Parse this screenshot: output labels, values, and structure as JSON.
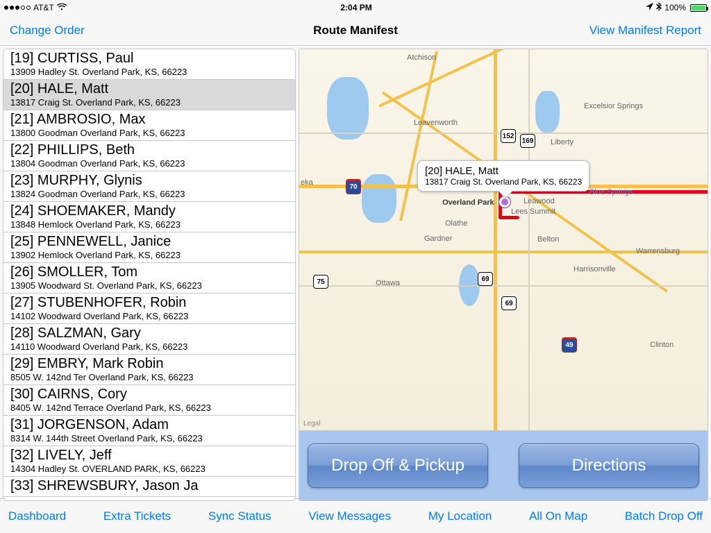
{
  "status": {
    "carrier": "AT&T",
    "time": "2:04 PM",
    "battery_text": "100%"
  },
  "nav": {
    "left": "Change Order",
    "title": "Route Manifest",
    "right": "View Manifest Report"
  },
  "selected_index": 1,
  "manifest": [
    {
      "stop": "[19]",
      "name": "CURTISS, Paul",
      "addr": "13909 Hadley St. Overland Park, KS, 66223"
    },
    {
      "stop": "[20]",
      "name": "HALE, Matt",
      "addr": "13817 Craig St. Overland Park, KS, 66223"
    },
    {
      "stop": "[21]",
      "name": "AMBROSIO, Max",
      "addr": "13800 Goodman Overland Park, KS, 66223"
    },
    {
      "stop": "[22]",
      "name": "PHILLIPS, Beth",
      "addr": "13804 Goodman Overland Park, KS, 66223"
    },
    {
      "stop": "[23]",
      "name": "MURPHY, Glynis",
      "addr": "13824 Goodman Overland Park, KS, 66223"
    },
    {
      "stop": "[24]",
      "name": "SHOEMAKER, Mandy",
      "addr": "13848 Hemlock Overland Park, KS, 66223"
    },
    {
      "stop": "[25]",
      "name": "PENNEWELL, Janice",
      "addr": "13902 Hemlock Overland Park, KS, 66223"
    },
    {
      "stop": "[26]",
      "name": "SMOLLER, Tom",
      "addr": "13905 Woodward St. Overland Park, KS, 66223"
    },
    {
      "stop": "[27]",
      "name": "STUBENHOFER, Robin",
      "addr": "14102 Woodward Overland Park, KS, 66223"
    },
    {
      "stop": "[28]",
      "name": "SALZMAN, Gary",
      "addr": "14110 Woodward Overland Park, KS, 66223"
    },
    {
      "stop": "[29]",
      "name": "EMBRY, Mark   Robin",
      "addr": "8505 W. 142nd Ter Overland Park, KS, 66223"
    },
    {
      "stop": "[30]",
      "name": "CAIRNS, Cory",
      "addr": "8405 W. 142nd Terrace Overland Park, KS, 66223"
    },
    {
      "stop": "[31]",
      "name": "JORGENSON, Adam",
      "addr": "8314 W. 144th Street Overland Park, KS, 66223"
    },
    {
      "stop": "[32]",
      "name": "LIVELY, Jeff",
      "addr": "14304 Hadley St. OVERLAND PARK, KS, 66223"
    },
    {
      "stop": "[33]",
      "name": "SHREWSBURY, Jason   Ja",
      "addr": ""
    }
  ],
  "callout": {
    "title": "[20]  HALE, Matt",
    "subtitle": "13817 Craig St. Overland Park, KS, 66223"
  },
  "map": {
    "cities": {
      "atchison": "Atchison",
      "leavenworth": "Leavenworth",
      "excelsior": "Excelsior Springs",
      "liberty": "Liberty",
      "eka": "eka",
      "overland": "Overland Park",
      "leawood": "Leawood",
      "olathe": "Olathe",
      "lees": "Lees Summit",
      "blue": "Blue Springs",
      "gardner": "Gardner",
      "belton": "Belton",
      "ottawa": "Ottawa",
      "harrisonville": "Harrisonville",
      "warrensburg": "Warrensburg",
      "clinton": "Clinton"
    },
    "shields": {
      "i70": "70",
      "i49": "49",
      "us152": "152",
      "us169": "169",
      "us69a": "69",
      "us69b": "69",
      "us75": "75"
    },
    "attrib": "Legal"
  },
  "actions": {
    "dropoff": "Drop Off & Pickup",
    "directions": "Directions"
  },
  "toolbar": {
    "dashboard": "Dashboard",
    "extra": "Extra Tickets",
    "sync": "Sync Status",
    "messages": "View Messages",
    "location": "My Location",
    "allmap": "All On Map",
    "batch": "Batch Drop Off"
  }
}
